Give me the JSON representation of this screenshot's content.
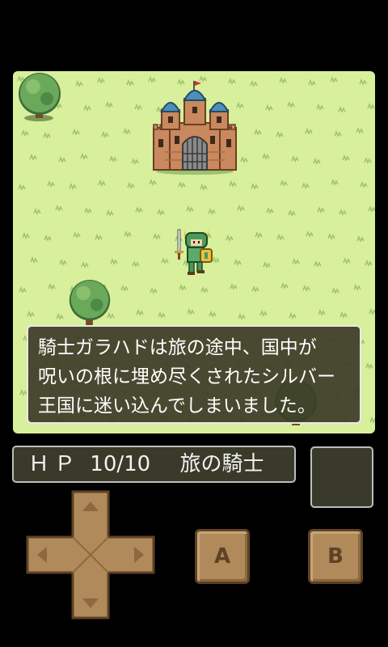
{
  "dialog": {
    "lines": [
      "騎士ガラハドは旅の途中、国中が",
      "呪いの根に埋め尽くされたシルバー",
      "王国に迷い込んでしまいました。"
    ]
  },
  "status": {
    "hp_label": "ＨＰ",
    "hp_value": "10/10",
    "title": "旅の騎士"
  },
  "controls": {
    "a_label": "A",
    "b_label": "B",
    "dpad_icons": [
      "arrow-up-icon",
      "arrow-down-icon",
      "arrow-left-icon",
      "arrow-right-icon"
    ]
  },
  "colors": {
    "grass": "#d8ef9c",
    "panel": "#3a3a2a",
    "button": "#b08a5a"
  }
}
